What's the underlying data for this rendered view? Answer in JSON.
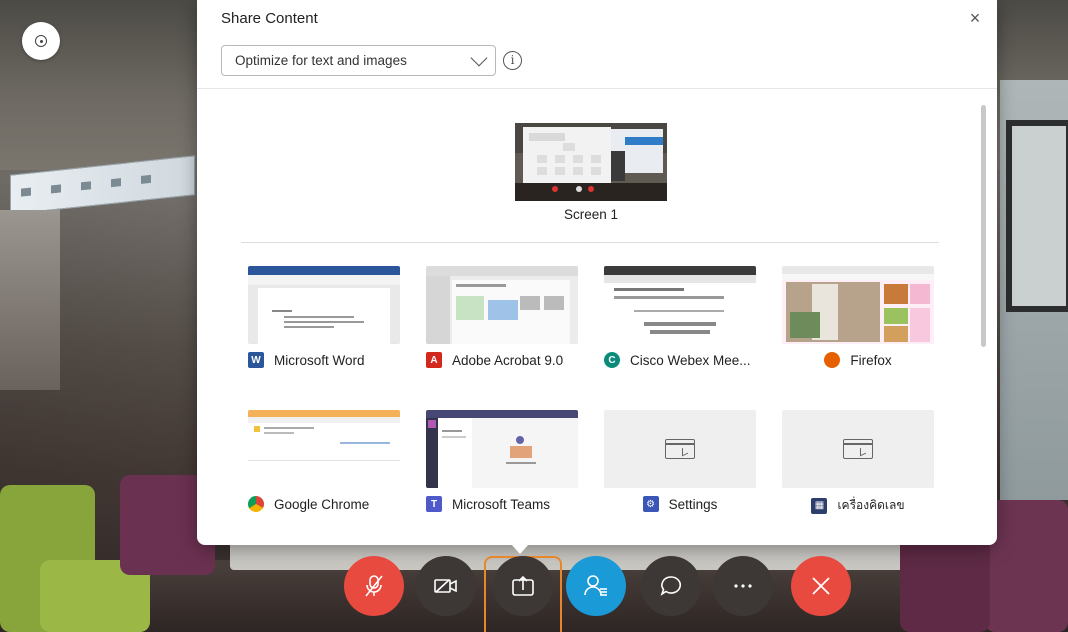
{
  "panel": {
    "title": "Share Content",
    "close_glyph": "×",
    "optimize_select": {
      "selected": "Optimize for text and images",
      "info_glyph": "i"
    }
  },
  "screens": [
    {
      "label": "Screen 1"
    }
  ],
  "apps": [
    {
      "label": "Microsoft Word",
      "icon": "word-icon",
      "color": "#2b579a"
    },
    {
      "label": "Adobe Acrobat 9.0",
      "icon": "acrobat-icon",
      "color": "#d3281d"
    },
    {
      "label": "Cisco Webex Mee...",
      "icon": "webex-icon",
      "color": "#0b8c7a"
    },
    {
      "label": "Firefox",
      "icon": "firefox-icon",
      "color": "#e66000"
    },
    {
      "label": "Google Chrome",
      "icon": "chrome-icon",
      "color": "#4285f4"
    },
    {
      "label": "Microsoft Teams",
      "icon": "teams-icon",
      "color": "#5059c9"
    },
    {
      "label": "Settings",
      "icon": "settings-icon",
      "color": "#3a57b8"
    },
    {
      "label": "เครื่องคิดเลข",
      "icon": "calculator-icon",
      "color": "#2c3e6b"
    }
  ],
  "controls": [
    {
      "name": "mute",
      "icon": "microphone-muted-icon",
      "color": "#e84a3f"
    },
    {
      "name": "video",
      "icon": "video-off-icon",
      "color": "#3d3836"
    },
    {
      "name": "share",
      "icon": "share-icon",
      "color": "#3d3836",
      "highlight": "#e8862c"
    },
    {
      "name": "participants",
      "icon": "participants-icon",
      "color": "#1a9ad6"
    },
    {
      "name": "chat",
      "icon": "chat-icon",
      "color": "#3d3836"
    },
    {
      "name": "more",
      "icon": "more-icon",
      "color": "#3d3836"
    },
    {
      "name": "end",
      "icon": "close-icon",
      "color": "#e84a3f"
    }
  ]
}
